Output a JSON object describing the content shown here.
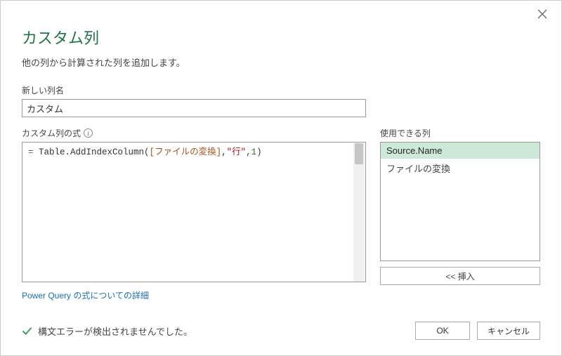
{
  "dialog": {
    "title": "カスタム列",
    "subtitle": "他の列から計算された列を追加します。"
  },
  "new_column": {
    "label": "新しい列名",
    "value": "カスタム"
  },
  "formula": {
    "label": "カスタム列の式",
    "prefix": "= ",
    "function": "Table.AddIndexColumn",
    "expr_column": "[ファイルの変換]",
    "arg_string": "\"行\"",
    "arg_number": "1"
  },
  "available": {
    "label": "使用できる列",
    "items": [
      {
        "name": "Source.Name",
        "selected": true
      },
      {
        "name": "ファイルの変換",
        "selected": false
      }
    ],
    "insert_label": "<< 挿入"
  },
  "link": {
    "text": "Power Query の式についての詳細"
  },
  "status": {
    "text": "構文エラーが検出されませんでした。"
  },
  "buttons": {
    "ok": "OK",
    "cancel": "キャンセル"
  }
}
